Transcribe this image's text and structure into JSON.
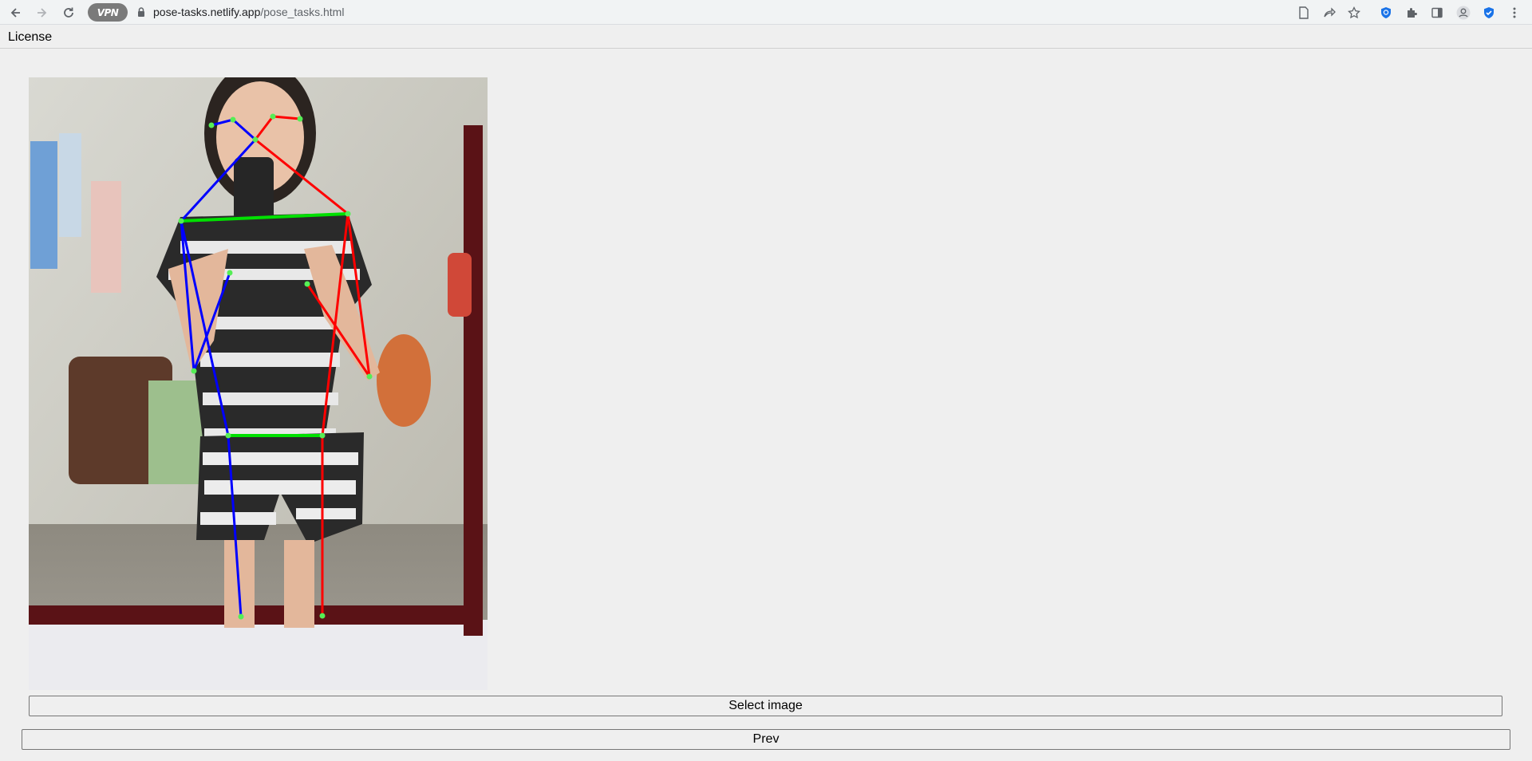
{
  "browser": {
    "back_icon": "arrow-left-icon",
    "forward_icon": "arrow-right-icon",
    "reload_icon": "reload-icon",
    "vpn_badge": "VPN",
    "url_host": "pose-tasks.netlify.app",
    "url_path": "/pose_tasks.html"
  },
  "page": {
    "license_link": "License",
    "select_image_button": "Select image",
    "prev_button": "Prev"
  },
  "pose": {
    "colors": {
      "left": "#0000ff",
      "right": "#ff0000",
      "center": "#00e000",
      "keypoint": "#55ee55"
    }
  }
}
